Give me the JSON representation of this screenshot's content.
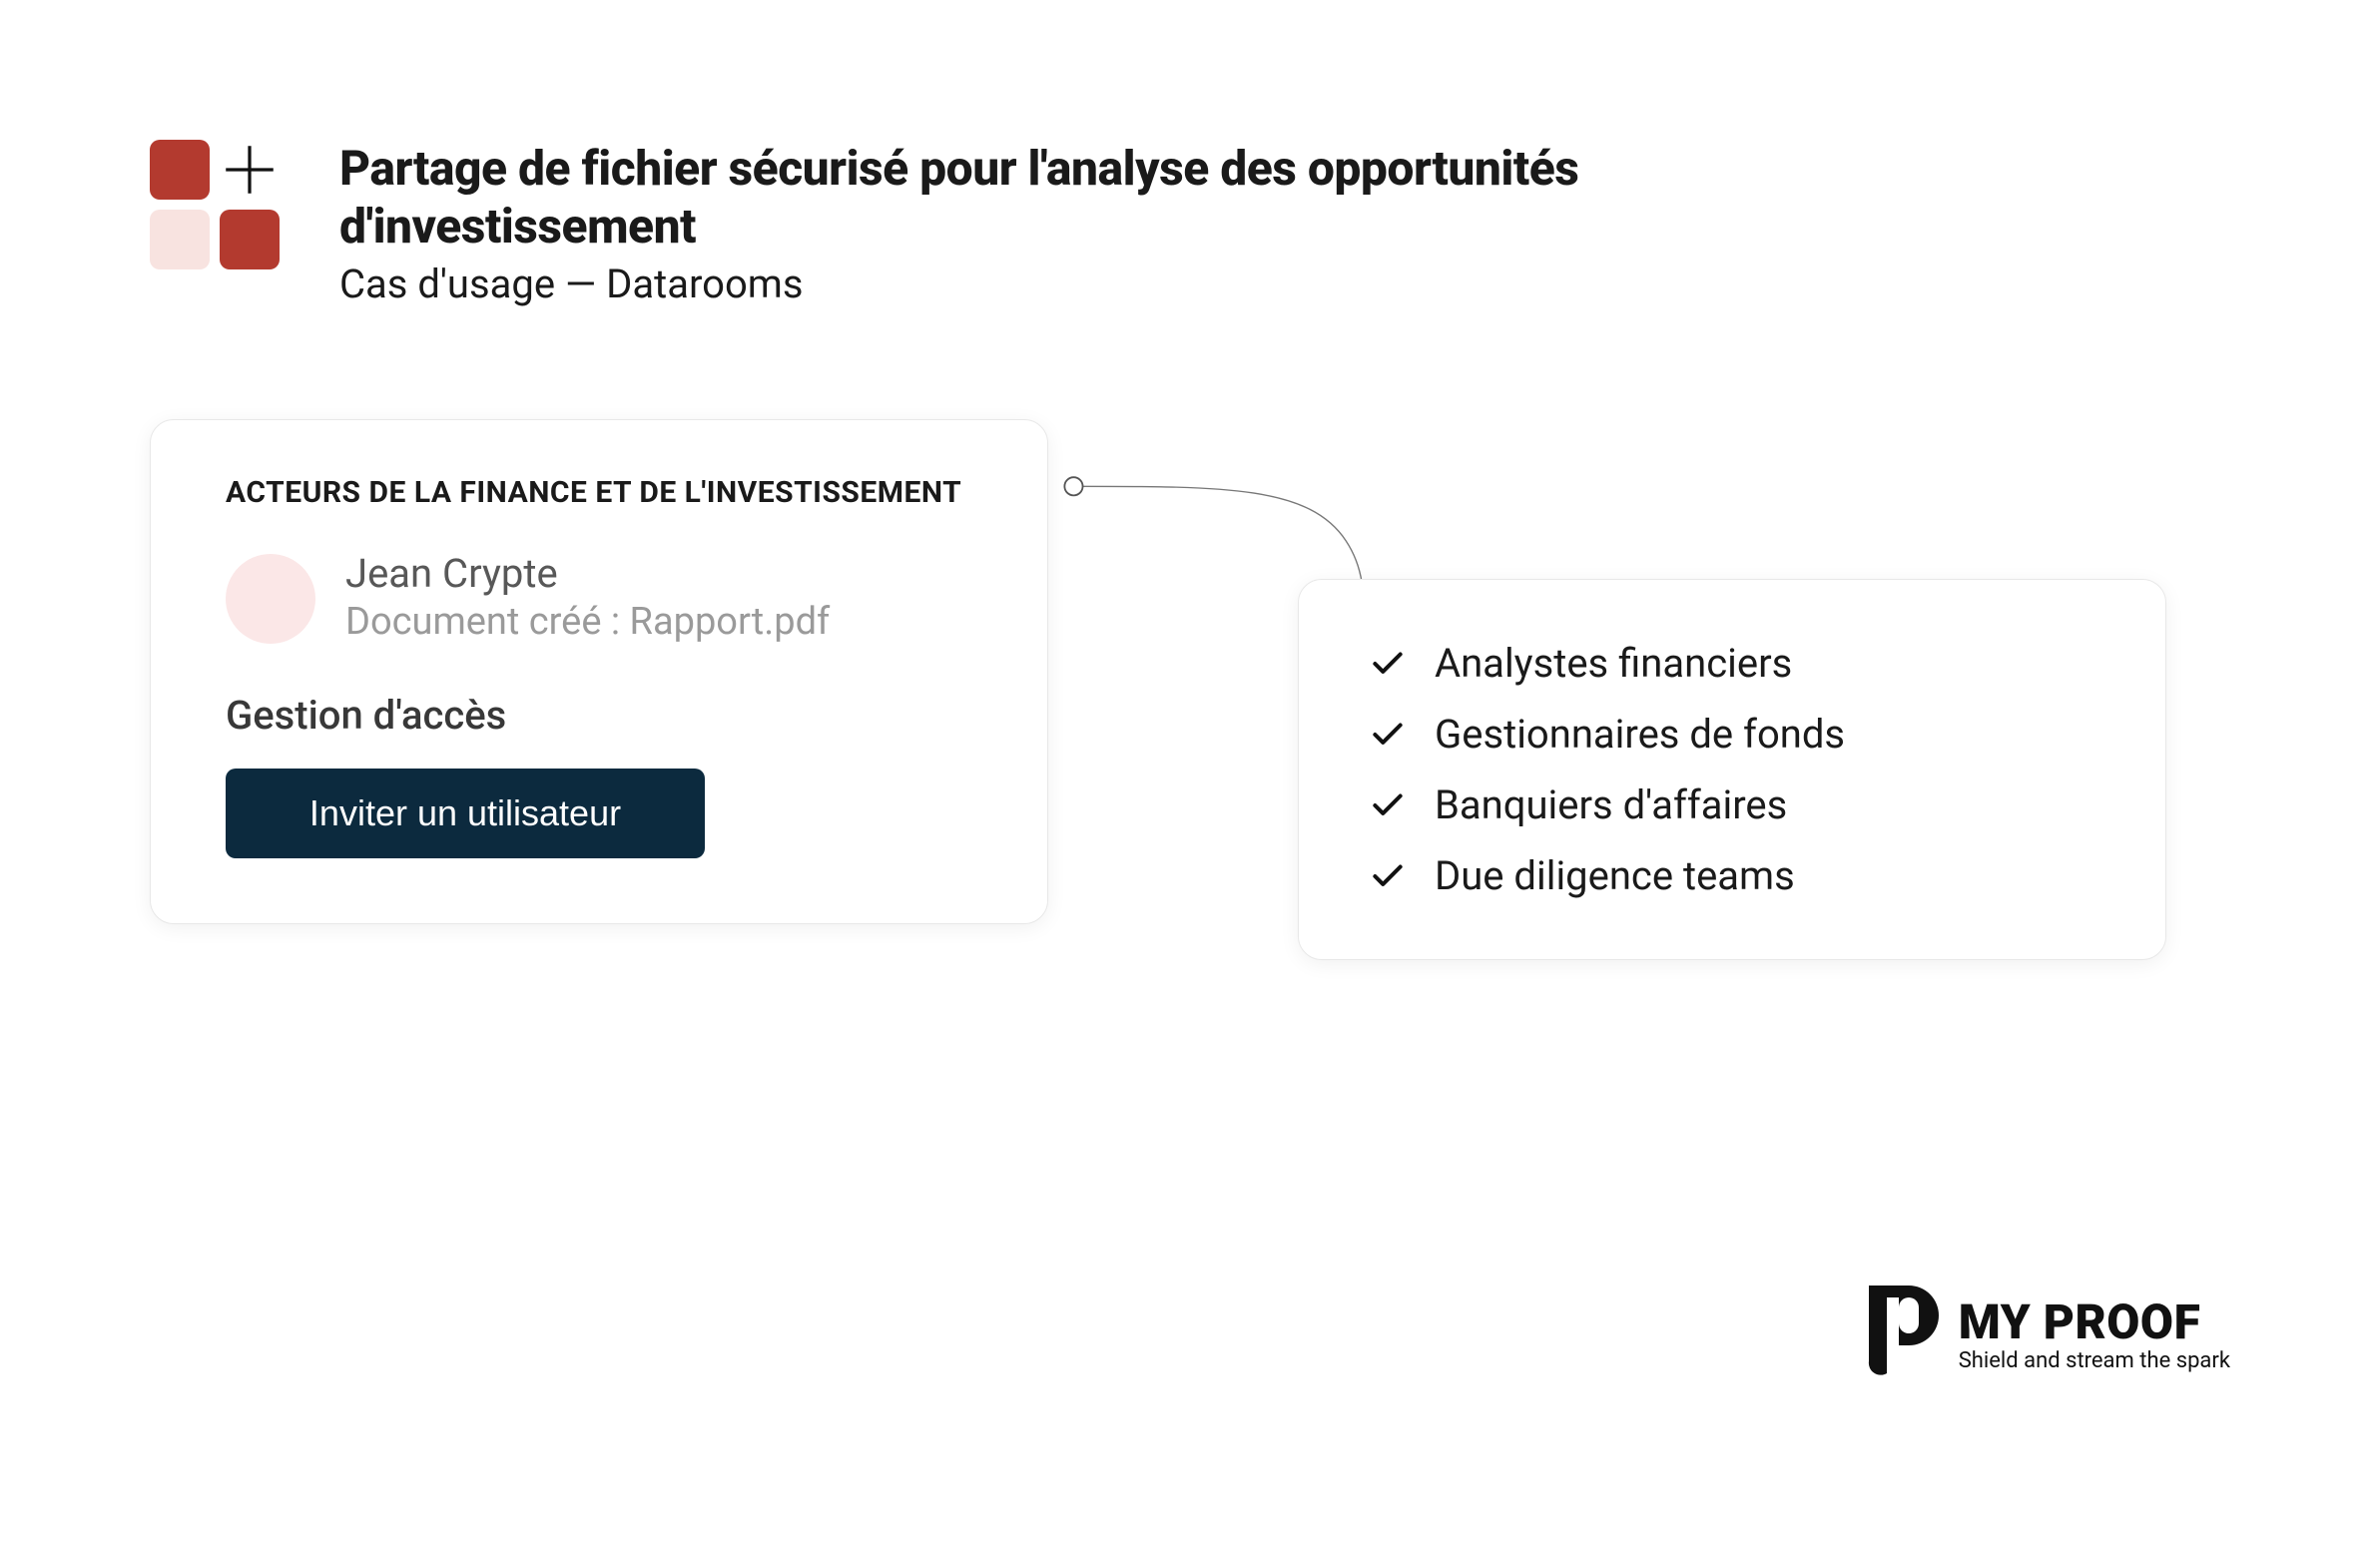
{
  "header": {
    "title": "Partage de fichier sécurisé pour l'analyse des opportunités d'investissement",
    "subtitle": "Cas d'usage — Datarooms"
  },
  "card_left": {
    "section_label": "ACTEURS DE LA FINANCE ET DE L'INVESTISSEMENT",
    "user_name": "Jean Crypte",
    "doc_line": "Document créé : Rapport.pdf",
    "access_label": "Gestion d'accès",
    "invite_button": "Inviter un utilisateur"
  },
  "roles": {
    "items": [
      "Analystes financiers",
      "Gestionnaires de fonds",
      "Banquiers d'affaires",
      "Due diligence teams"
    ]
  },
  "footer": {
    "brand_name": "MY PROOF",
    "tagline": "Shield and stream the spark"
  },
  "colors": {
    "brand_red": "#B33A2F",
    "brand_red_light": "#F8E3E0",
    "btn_dark": "#0C2A3E"
  }
}
